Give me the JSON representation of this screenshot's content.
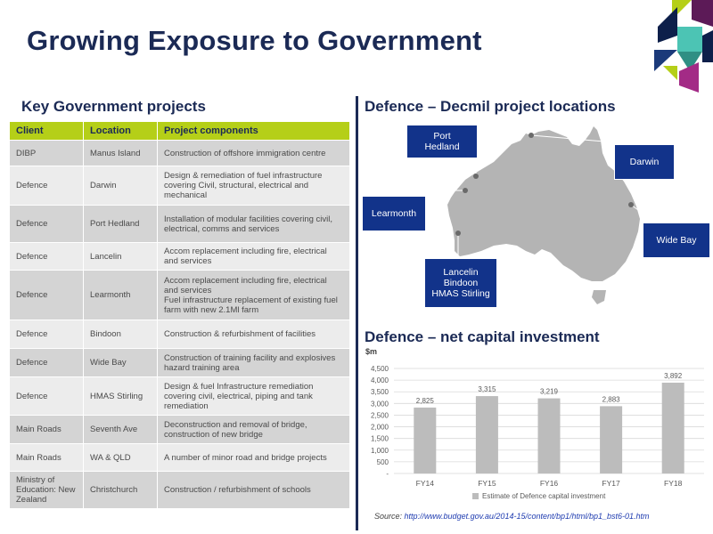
{
  "title": "Growing Exposure to Government",
  "left_heading": "Key Government projects",
  "map_heading": "Defence – Decmil project locations",
  "chart_heading": "Defence – net capital investment",
  "table": {
    "headers": [
      "Client",
      "Location",
      "Project components"
    ],
    "rows": [
      {
        "client": "DIBP",
        "location": "Manus Island",
        "components": "Construction of offshore immigration centre"
      },
      {
        "client": "Defence",
        "location": "Darwin",
        "components": "Design & remediation of fuel infrastructure covering Civil, structural, electrical and mechanical"
      },
      {
        "client": "Defence",
        "location": "Port Hedland",
        "components": "Installation of modular facilities covering civil, electrical, comms and services"
      },
      {
        "client": "Defence",
        "location": "Lancelin",
        "components": "Accom replacement including fire, electrical and services"
      },
      {
        "client": "Defence",
        "location": "Learmonth",
        "components": "Accom replacement including fire, electrical and services\nFuel infrastructure replacement of existing fuel farm with new 2.1Ml farm"
      },
      {
        "client": "Defence",
        "location": "Bindoon",
        "components": "Construction & refurbishment of facilities"
      },
      {
        "client": "Defence",
        "location": "Wide Bay",
        "components": "Construction of training facility and explosives hazard training area"
      },
      {
        "client": "Defence",
        "location": "HMAS Stirling",
        "components": "Design & fuel Infrastructure remediation covering civil, electrical, piping and tank remediation"
      },
      {
        "client": "Main Roads",
        "location": "Seventh Ave",
        "components": "Deconstruction and removal of bridge, construction of new bridge"
      },
      {
        "client": "Main Roads",
        "location": "WA & QLD",
        "components": "A number of minor road and bridge projects"
      },
      {
        "client": "Ministry of Education: New Zealand",
        "location": "Christchurch",
        "components": "Construction / refurbishment of schools"
      }
    ]
  },
  "map_labels": {
    "port_hedland": "Port\nHedland",
    "darwin": "Darwin",
    "learmonth": "Learmonth",
    "wide_bay": "Wide Bay",
    "perth_group": "Lancelin\nBindoon\nHMAS Stirling"
  },
  "colors": {
    "title_navy": "#1b2a55",
    "header_green": "#b5cf18",
    "label_blue": "#12338a",
    "map_grey": "#b4b4b4",
    "bar_grey": "#bcbcbc"
  },
  "chart_data": {
    "type": "bar",
    "unit_label": "$m",
    "categories": [
      "FY14",
      "FY15",
      "FY16",
      "FY17",
      "FY18"
    ],
    "series": [
      {
        "name": "Estimate of Defence capital investment",
        "values": [
          2825,
          3315,
          3219,
          2883,
          3892
        ]
      }
    ],
    "data_labels": [
      "2,825",
      "3,315",
      "3,219",
      "2,883",
      "3,892"
    ],
    "ylim": [
      0,
      4500
    ],
    "yticks": [
      0,
      500,
      1000,
      1500,
      2000,
      2500,
      3000,
      3500,
      4000,
      4500
    ],
    "ytick_labels": [
      "-",
      "500",
      "1,000",
      "1,500",
      "2,000",
      "2,500",
      "3,000",
      "3,500",
      "4,000",
      "4,500"
    ],
    "grid": true,
    "legend_position": "bottom"
  },
  "source": {
    "prefix": "Source: ",
    "link": "http://www.budget.gov.au/2014-15/content/bp1/html/bp1_bst6-01.htm"
  }
}
